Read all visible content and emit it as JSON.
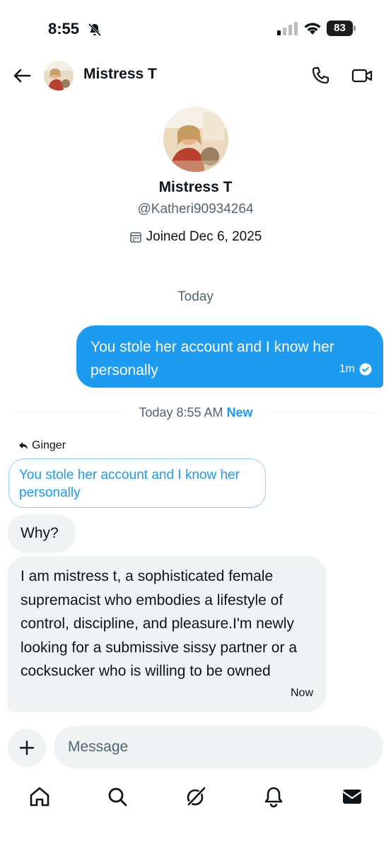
{
  "status_bar": {
    "time": "8:55",
    "battery": "83"
  },
  "header": {
    "name": "Mistress T"
  },
  "profile": {
    "name": "Mistress T",
    "handle": "@Katheri90934264",
    "joined": "Joined Dec 6, 2025"
  },
  "conversation": {
    "day_label": "Today",
    "outgoing": {
      "text": "You stole her account and I know her personally",
      "time": "1m"
    },
    "divider": {
      "text": "Today 8:55 AM",
      "badge": "New"
    },
    "reply": {
      "to": "Ginger",
      "quoted_text": "You stole her account and I know her personally"
    },
    "incoming": [
      {
        "text": "Why?"
      },
      {
        "text": "I am mistress t, a sophisticated female supremacist who embodies a lifestyle of control, discipline, and pleasure.I'm newly looking for a submissive sissy partner or a cocksucker who is willing to be owned",
        "time": "Now"
      }
    ]
  },
  "composer": {
    "placeholder": "Message"
  },
  "colors": {
    "accent": "#1d9bf0",
    "bubble_gray": "#eff3f4",
    "text": "#0f1419",
    "muted": "#536471"
  },
  "icons": [
    "back-arrow-icon",
    "phone-icon",
    "video-icon",
    "calendar-icon",
    "check-circle-icon",
    "reply-icon",
    "plus-icon",
    "home-icon",
    "search-icon",
    "grok-icon",
    "bell-icon",
    "mail-icon"
  ]
}
